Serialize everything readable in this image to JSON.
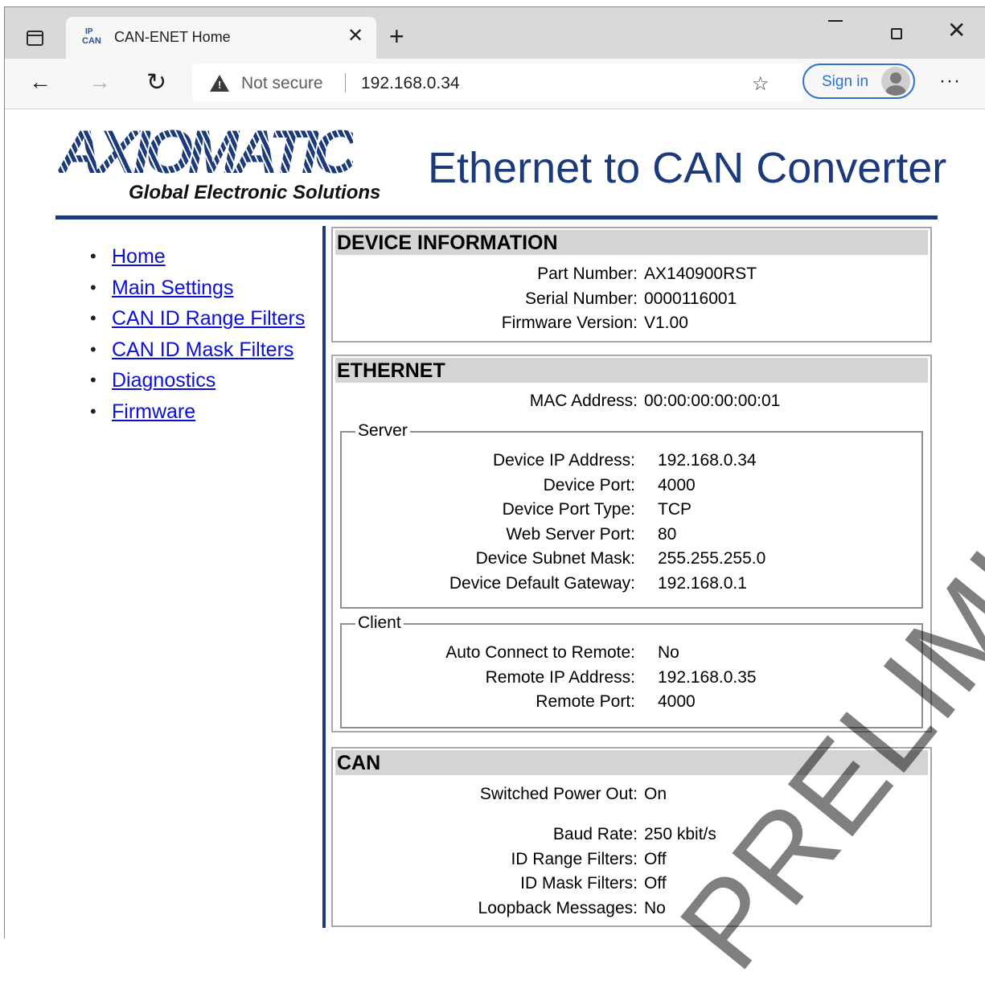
{
  "browser": {
    "tab": {
      "favicon_top": "IP",
      "favicon_bottom": "CAN",
      "title": "CAN-ENET Home",
      "close_glyph": "✕"
    },
    "new_tab_glyph": "+",
    "window": {
      "minimize": "minimize",
      "maximize": "maximize",
      "close_glyph": "✕"
    },
    "toolbar": {
      "back_glyph": "←",
      "forward_glyph": "→",
      "reload_glyph": "↻",
      "more_glyph": "···"
    },
    "security_label": "Not secure",
    "url": "192.168.0.34",
    "favorites_glyph": "☆",
    "sign_in_label": "Sign in",
    "icons": [
      "tabs-icon",
      "favicon-icon",
      "close-icon",
      "plus-icon",
      "back-arrow-icon",
      "forward-arrow-icon",
      "reload-icon",
      "warning-icon",
      "add-favorite-icon",
      "profile-avatar-icon",
      "more-icon"
    ]
  },
  "header": {
    "logo_text": "AXIOMATIC",
    "logo_tagline": "Global Electronic Solutions",
    "title": "Ethernet to CAN Converter",
    "brand_color": "#1b3a7c"
  },
  "nav": {
    "items": [
      {
        "label": "Home"
      },
      {
        "label": "Main Settings"
      },
      {
        "label": "CAN ID Range Filters"
      },
      {
        "label": "CAN ID Mask Filters"
      },
      {
        "label": "Diagnostics"
      },
      {
        "label": "Firmware"
      }
    ],
    "link_color": "#0b10d6"
  },
  "device_info": {
    "heading": "DEVICE INFORMATION",
    "part_number": {
      "label": "Part Number:",
      "value": "AX140900RST"
    },
    "serial_number": {
      "label": "Serial Number:",
      "value": "0000116001"
    },
    "firmware_version": {
      "label": "Firmware Version:",
      "value": "V1.00"
    }
  },
  "ethernet": {
    "heading": "ETHERNET",
    "mac_address": {
      "label": "MAC Address:",
      "value": "00:00:00:00:00:01"
    },
    "server": {
      "legend": "Server",
      "device_ip": {
        "label": "Device IP Address:",
        "value": "192.168.0.34"
      },
      "device_port": {
        "label": "Device Port:",
        "value": "4000"
      },
      "device_port_type": {
        "label": "Device Port Type:",
        "value": "TCP"
      },
      "web_server_port": {
        "label": "Web Server Port:",
        "value": "80"
      },
      "subnet_mask": {
        "label": "Device Subnet Mask:",
        "value": "255.255.255.0"
      },
      "default_gateway": {
        "label": "Device Default Gateway:",
        "value": "192.168.0.1"
      }
    },
    "client": {
      "legend": "Client",
      "auto_connect": {
        "label": "Auto Connect to Remote:",
        "value": "No"
      },
      "remote_ip": {
        "label": "Remote IP Address:",
        "value": "192.168.0.35"
      },
      "remote_port": {
        "label": "Remote Port:",
        "value": "4000"
      }
    }
  },
  "can": {
    "heading": "CAN",
    "switched_power_out": {
      "label": "Switched Power Out:",
      "value": "On"
    },
    "baud_rate": {
      "label": "Baud Rate:",
      "value": "250 kbit/s"
    },
    "id_range_filters": {
      "label": "ID Range Filters:",
      "value": "Off"
    },
    "id_mask_filters": {
      "label": "ID Mask Filters:",
      "value": "Off"
    },
    "loopback_messages": {
      "label": "Loopback Messages:",
      "value": "No"
    }
  },
  "watermark": "PRELIMINARY"
}
